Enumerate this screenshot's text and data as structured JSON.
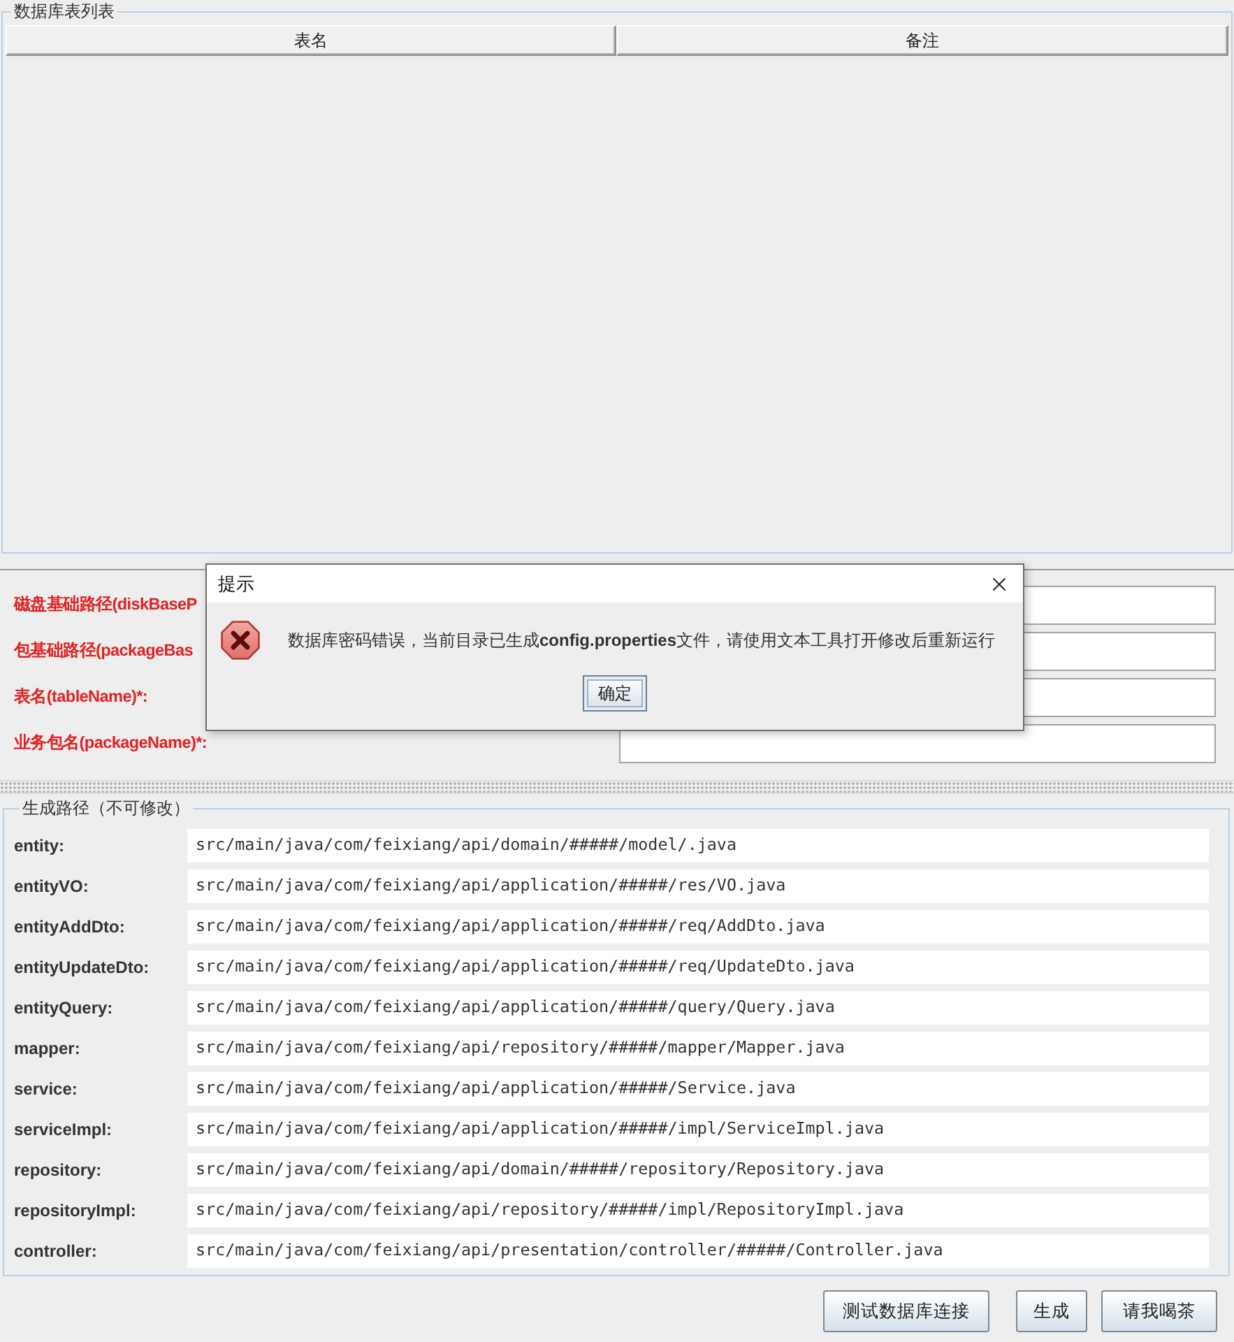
{
  "table_panel": {
    "title": "数据库表列表",
    "columns": [
      "表名",
      "备注"
    ]
  },
  "form": {
    "fields": [
      {
        "label": "磁盘基础路径(diskBaseP"
      },
      {
        "label": "包基础路径(packageBas"
      },
      {
        "label": "表名(tableName)*:"
      },
      {
        "label": "业务包名(packageName)*:"
      }
    ]
  },
  "paths_panel": {
    "title": "生成路径（不可修改）",
    "rows": [
      {
        "label": "entity:",
        "value": "src/main/java/com/feixiang/api/domain/#####/model/.java"
      },
      {
        "label": "entityVO:",
        "value": "src/main/java/com/feixiang/api/application/#####/res/VO.java"
      },
      {
        "label": "entityAddDto:",
        "value": "src/main/java/com/feixiang/api/application/#####/req/AddDto.java"
      },
      {
        "label": "entityUpdateDto:",
        "value": "src/main/java/com/feixiang/api/application/#####/req/UpdateDto.java"
      },
      {
        "label": "entityQuery:",
        "value": "src/main/java/com/feixiang/api/application/#####/query/Query.java"
      },
      {
        "label": "mapper:",
        "value": "src/main/java/com/feixiang/api/repository/#####/mapper/Mapper.java"
      },
      {
        "label": "service:",
        "value": "src/main/java/com/feixiang/api/application/#####/Service.java"
      },
      {
        "label": "serviceImpl:",
        "value": "src/main/java/com/feixiang/api/application/#####/impl/ServiceImpl.java"
      },
      {
        "label": "repository:",
        "value": "src/main/java/com/feixiang/api/domain/#####/repository/Repository.java"
      },
      {
        "label": "repositoryImpl:",
        "value": "src/main/java/com/feixiang/api/repository/#####/impl/RepositoryImpl.java"
      },
      {
        "label": "controller:",
        "value": "src/main/java/com/feixiang/api/presentation/controller/#####/Controller.java"
      }
    ]
  },
  "buttons": [
    "测试数据库连接",
    "生成",
    "请我喝茶"
  ],
  "dialog": {
    "title": "提示",
    "message": "数据库密码错误，当前目录已生成**config.properties**文件，请使用文本工具打开修改后重新运行",
    "buttons": [
      "确定"
    ]
  }
}
